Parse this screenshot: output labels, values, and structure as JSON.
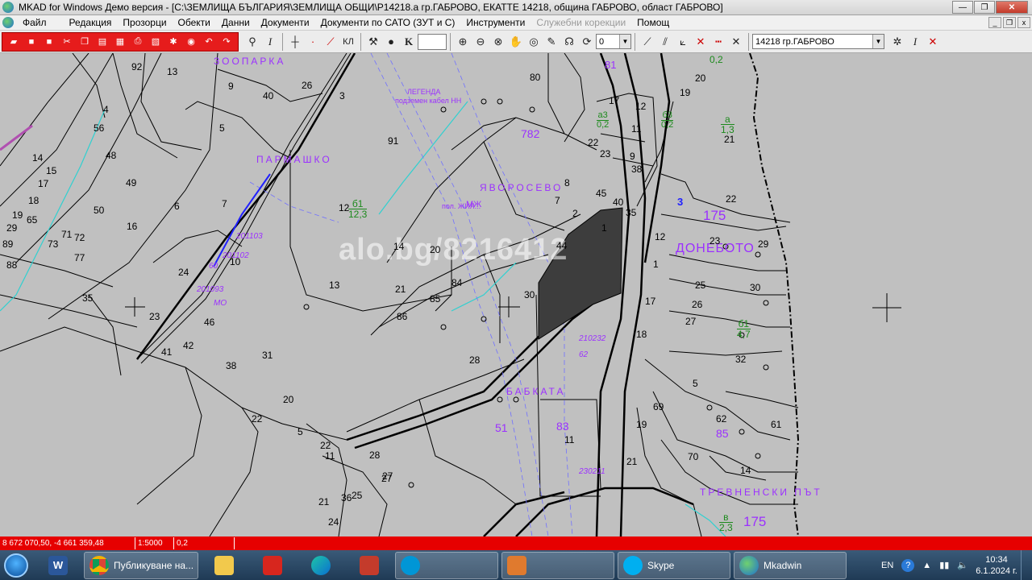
{
  "window": {
    "title": "MKAD for Windows Демо версия  - [C:\\ЗЕМЛИЩА БЪЛГАРИЯ\\ЗЕМЛИЩА ОБЩИ\\P14218.a гр.ГАБРОВО, ЕКАТТЕ 14218, община ГАБРОВО, област ГАБРОВО]",
    "minimize": "—",
    "maximize": "❐",
    "close": "✕"
  },
  "menu": {
    "items": [
      {
        "label": "Файл"
      },
      {
        "label": "Редакция"
      },
      {
        "label": "Прозорци"
      },
      {
        "label": "Обекти"
      },
      {
        "label": "Данни"
      },
      {
        "label": "Документи"
      },
      {
        "label": "Документи по САТО (ЗУТ и С)"
      },
      {
        "label": "Инструменти"
      },
      {
        "label": "Служебни корекции",
        "disabled": true
      },
      {
        "label": "Помощ"
      }
    ],
    "mdi_min": "_",
    "mdi_restore": "❐",
    "mdi_close": "x"
  },
  "toolbar": {
    "kl_label": "КЛ",
    "k_label": "K",
    "layer_value": "0",
    "settlement_value": "14218 гр.ГАБРОВО"
  },
  "map": {
    "locality_labels": [
      {
        "text": "ЗООПАРКА"
      },
      {
        "text": "ПАРМАШКО"
      },
      {
        "text": "ЯВОРОСЕВО"
      },
      {
        "text": "ДОНЕБОТО"
      },
      {
        "text": "БАБКАТА"
      },
      {
        "text": "ТРЕВНЕНСКИ ПЪТ"
      }
    ],
    "block_numbers": [
      {
        "text": "81"
      },
      {
        "text": "782"
      },
      {
        "text": "175"
      },
      {
        "text": "3"
      },
      {
        "text": "83"
      },
      {
        "text": "85"
      },
      {
        "text": "51"
      },
      {
        "text": "175"
      }
    ],
    "parcel_numbers": [
      {
        "text": "92"
      },
      {
        "text": "13"
      },
      {
        "text": "9"
      },
      {
        "text": "26"
      },
      {
        "text": "40"
      },
      {
        "text": "80"
      },
      {
        "text": "3"
      },
      {
        "text": "4"
      },
      {
        "text": "5"
      },
      {
        "text": "91"
      },
      {
        "text": "56"
      },
      {
        "text": "48"
      },
      {
        "text": "49"
      },
      {
        "text": "50"
      },
      {
        "text": "14"
      },
      {
        "text": "15"
      },
      {
        "text": "17"
      },
      {
        "text": "18"
      },
      {
        "text": "19"
      },
      {
        "text": "65"
      },
      {
        "text": "29"
      },
      {
        "text": "89"
      },
      {
        "text": "88"
      },
      {
        "text": "73"
      },
      {
        "text": "72"
      },
      {
        "text": "71"
      },
      {
        "text": "77"
      },
      {
        "text": "16"
      },
      {
        "text": "6"
      },
      {
        "text": "7"
      },
      {
        "text": "10"
      },
      {
        "text": "12"
      },
      {
        "text": "24"
      },
      {
        "text": "35"
      },
      {
        "text": "23"
      },
      {
        "text": "41"
      },
      {
        "text": "42"
      },
      {
        "text": "46"
      },
      {
        "text": "38"
      },
      {
        "text": "31"
      },
      {
        "text": "13"
      },
      {
        "text": "21"
      },
      {
        "text": "86"
      },
      {
        "text": "85"
      },
      {
        "text": "84"
      },
      {
        "text": "20"
      },
      {
        "text": "14"
      },
      {
        "text": "30"
      },
      {
        "text": "28"
      },
      {
        "text": "22"
      },
      {
        "text": "5"
      },
      {
        "text": "27"
      },
      {
        "text": "17"
      },
      {
        "text": "12"
      },
      {
        "text": "11"
      },
      {
        "text": "22"
      },
      {
        "text": "23"
      },
      {
        "text": "9"
      },
      {
        "text": "38"
      },
      {
        "text": "45"
      },
      {
        "text": "40"
      },
      {
        "text": "35"
      },
      {
        "text": "1"
      },
      {
        "text": "44"
      },
      {
        "text": "2"
      },
      {
        "text": "8"
      },
      {
        "text": "7"
      },
      {
        "text": "1"
      },
      {
        "text": "12"
      },
      {
        "text": "17"
      },
      {
        "text": "18"
      },
      {
        "text": "25"
      },
      {
        "text": "26"
      },
      {
        "text": "27"
      },
      {
        "text": "30"
      },
      {
        "text": "32"
      },
      {
        "text": "22"
      },
      {
        "text": "29"
      },
      {
        "text": "23"
      },
      {
        "text": "21"
      },
      {
        "text": "20"
      },
      {
        "text": "19"
      },
      {
        "text": "69"
      },
      {
        "text": "70"
      },
      {
        "text": "14"
      },
      {
        "text": "61"
      },
      {
        "text": "5"
      },
      {
        "text": "62"
      },
      {
        "text": "11"
      },
      {
        "text": "21"
      },
      {
        "text": "19"
      },
      {
        "text": "11"
      },
      {
        "text": "28"
      },
      {
        "text": "27"
      },
      {
        "text": "25"
      },
      {
        "text": "36"
      },
      {
        "text": "24"
      },
      {
        "text": "21"
      },
      {
        "text": "20"
      },
      {
        "text": "22"
      },
      {
        "text": "9"
      },
      {
        "text": "3"
      }
    ],
    "fraction_labels": [
      {
        "num": "б1",
        "den": "12,3"
      },
      {
        "num": "а",
        "den": "1,3"
      },
      {
        "num": "а3",
        "den": "0,2"
      },
      {
        "num": "б3",
        "den": "0,2"
      },
      {
        "num": "б1",
        "den": "4,7"
      },
      {
        "num": "в",
        "den": "2,3"
      },
      {
        "num": "",
        "den": "0,2"
      }
    ],
    "point_labels": [
      {
        "text": "201103"
      },
      {
        "text": "201102"
      },
      {
        "text": "201093"
      },
      {
        "text": "210232"
      },
      {
        "text": "62"
      },
      {
        "text": "230211"
      },
      {
        "text": "60"
      },
      {
        "text": "МО"
      }
    ],
    "legend": {
      "title": "ЛЕГЕНДА",
      "text": "подземен кабел НН"
    },
    "watermark": "alo.bg/8216412",
    "misc_labels": [
      {
        "text": "пол. ЖИЛ..."
      },
      {
        "text": "МЖ"
      }
    ]
  },
  "status": {
    "coords": "8 672 070,50, -4 661 359,48",
    "scale": "1:5000",
    "value": "0,2"
  },
  "taskbar": {
    "word_label": "W",
    "chrome_label": "Публикуване на...",
    "skype_label": "Skype",
    "mkad_label": "Mkadwin",
    "lang": "EN",
    "time": "10:34",
    "date": "6.1.2024 г."
  }
}
